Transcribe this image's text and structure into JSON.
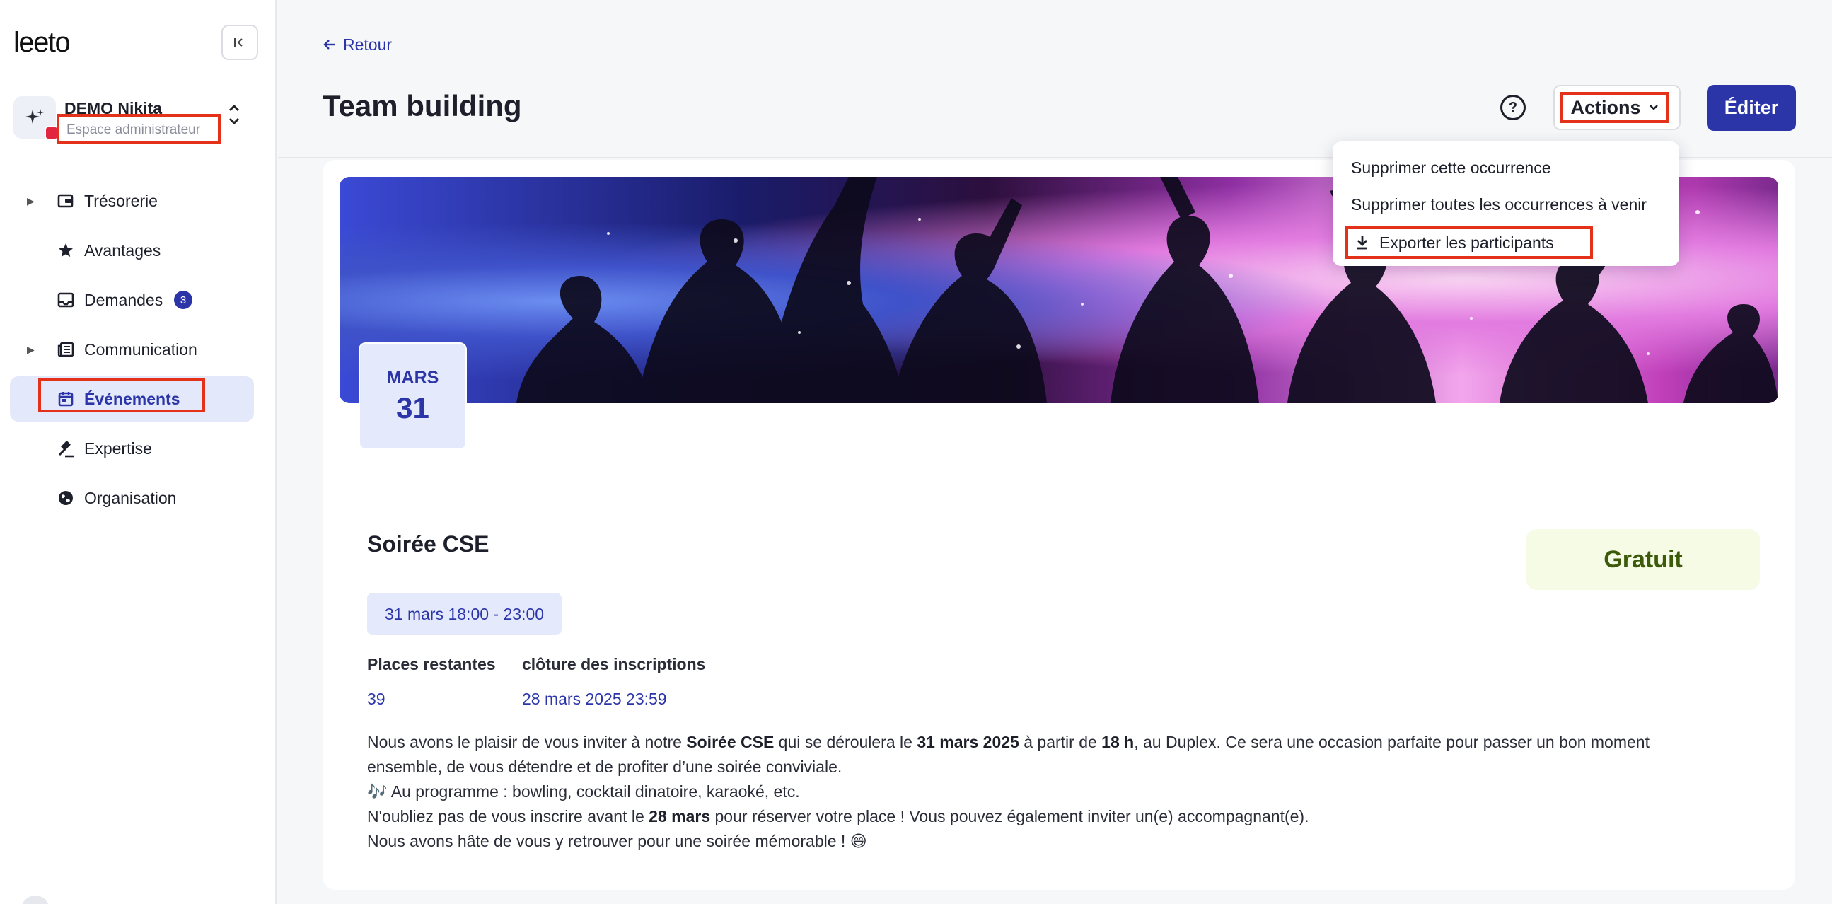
{
  "sidebar": {
    "logo": "leeto",
    "workspace": {
      "name": "DEMO Nikita",
      "subtitle": "Espace administrateur"
    },
    "items": [
      {
        "label": "Trésorerie",
        "icon": "wallet-icon",
        "expandable": true
      },
      {
        "label": "Avantages",
        "icon": "star-icon",
        "expandable": false
      },
      {
        "label": "Demandes",
        "icon": "inbox-icon",
        "expandable": false,
        "badge": "3"
      },
      {
        "label": "Communication",
        "icon": "newspaper-icon",
        "expandable": true
      },
      {
        "label": "Événements",
        "icon": "calendar-icon",
        "expandable": false,
        "active": true
      },
      {
        "label": "Expertise",
        "icon": "gavel-icon",
        "expandable": false
      },
      {
        "label": "Organisation",
        "icon": "globe-icon",
        "expandable": false
      }
    ]
  },
  "header": {
    "back_label": "Retour",
    "title": "Team building",
    "actions_label": "Actions",
    "edit_label": "Éditer"
  },
  "dropdown": {
    "items": [
      "Supprimer cette occurrence",
      "Supprimer toutes les occurrences à venir",
      "Exporter les participants"
    ]
  },
  "event": {
    "date_month": "MARS",
    "date_day": "31",
    "title": "Soirée CSE",
    "price": "Gratuit",
    "time": "31 mars 18:00 - 23:00",
    "places_label": "Places restantes",
    "places_value": "39",
    "closing_label": "clôture des inscriptions",
    "closing_value": "28 mars 2025 23:59",
    "description": {
      "l1a": "Nous avons le plaisir de vous inviter à notre ",
      "l1b": "Soirée CSE",
      "l1c": " qui se déroulera le ",
      "l1d": "31 mars 2025",
      "l1e": " à partir de ",
      "l1f": "18 h",
      "l1g": ", au Duplex. Ce sera une occasion parfaite pour passer un bon moment",
      "l2": "ensemble, de vous détendre et de profiter d’une soirée conviviale.",
      "l3": "🎶 Au programme : bowling, cocktail dinatoire, karaoké, etc.",
      "l4a": "N'oubliez pas de vous inscrire avant le ",
      "l4b": "28 mars",
      "l4c": " pour réserver votre place ! Vous pouvez également inviter un(e) accompagnant(e).",
      "l5": "Nous avons hâte de vous y retrouver pour une soirée mémorable ! 😄"
    }
  },
  "colors": {
    "accent": "#2b35a8",
    "highlight_box": "#e4321a",
    "price_bg": "#f6fbe6"
  }
}
